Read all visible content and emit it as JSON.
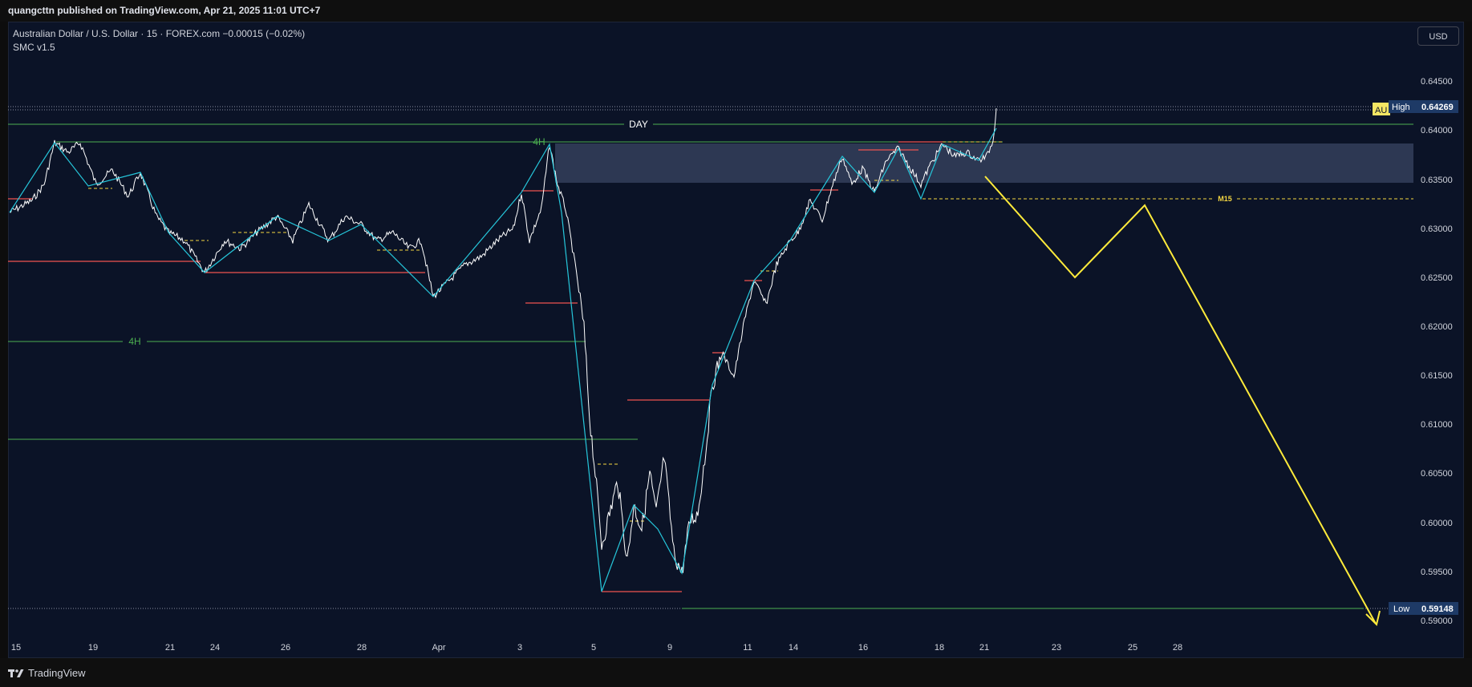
{
  "header": {
    "publisher_text": "quangcttn published on TradingView.com, Apr 21, 2025 11:01 UTC+7"
  },
  "legend": {
    "symbol_line": "Australian Dollar / U.S. Dollar · 15 · FOREX.com  −0.00015 (−0.02%)",
    "indicator": "SMC v1.5"
  },
  "currency_button": "USD",
  "price_axis": {
    "ticks": [
      "0.64500",
      "0.64000",
      "0.63500",
      "0.63000",
      "0.62500",
      "0.62000",
      "0.61500",
      "0.61000",
      "0.60500",
      "0.60000",
      "0.59500",
      "0.59000"
    ],
    "high_label": "High",
    "high_value": "0.64269",
    "low_label": "Low",
    "low_value": "0.59148",
    "symbol_tag": "AU"
  },
  "time_axis": {
    "ticks": [
      "15",
      "19",
      "21",
      "24",
      "26",
      "28",
      "Apr",
      "3",
      "5",
      "9",
      "11",
      "14",
      "16",
      "18",
      "21",
      "23",
      "25",
      "28"
    ]
  },
  "annotations": {
    "day_label": "DAY",
    "h4_label_top": "4H",
    "h4_label_mid": "4H",
    "m15_label": "M15"
  },
  "colors": {
    "background": "#0b1327",
    "price_line": "#ffffff",
    "structure_line": "#26c6da",
    "level_green": "#4caf50",
    "level_red": "#f05350",
    "dashed_yellow": "#f5d742",
    "projection": "#ffeb3b",
    "zone_fill": "#3a4663"
  },
  "brand": {
    "logo_icon": "tradingview-logo-icon",
    "logo_text": "TradingView"
  }
}
